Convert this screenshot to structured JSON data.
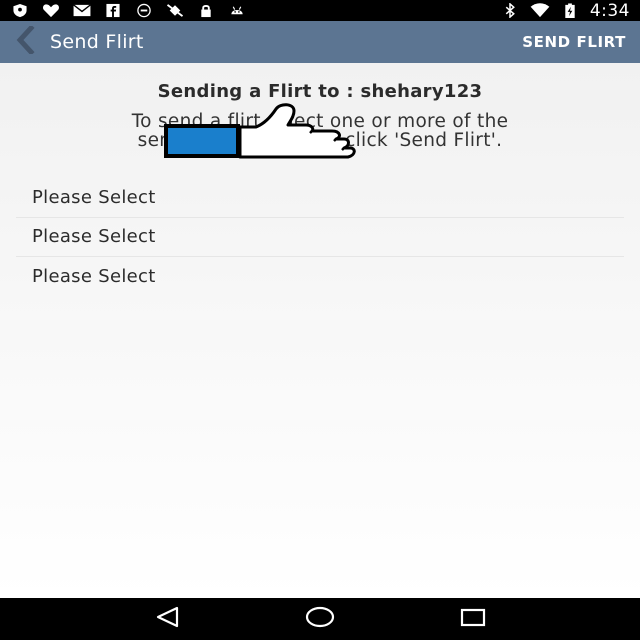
{
  "status_bar": {
    "icons_left": [
      "shield-icon",
      "heart-icon",
      "mail-icon",
      "facebook-icon",
      "settings-circle-icon",
      "no-satellite-icon",
      "lock-icon",
      "android-icon"
    ],
    "icons_right": [
      "bluetooth-icon",
      "wifi-icon",
      "battery-icon"
    ],
    "time": "4:34"
  },
  "app_bar": {
    "title": "Send Flirt",
    "action_label": "SEND FLIRT",
    "color": "#5c7592"
  },
  "main": {
    "heading": "Sending a Flirt to : shehary123",
    "instructions_line1": "To send a flirt select one or more of the",
    "instructions_line2": "sentences below and click 'Send Flirt'.",
    "selects": [
      {
        "label": "Please Select"
      },
      {
        "label": "Please Select"
      },
      {
        "label": "Please Select"
      }
    ]
  },
  "nav_bar": {
    "buttons": [
      "back-triangle-icon",
      "home-circle-icon",
      "recents-square-icon"
    ]
  }
}
